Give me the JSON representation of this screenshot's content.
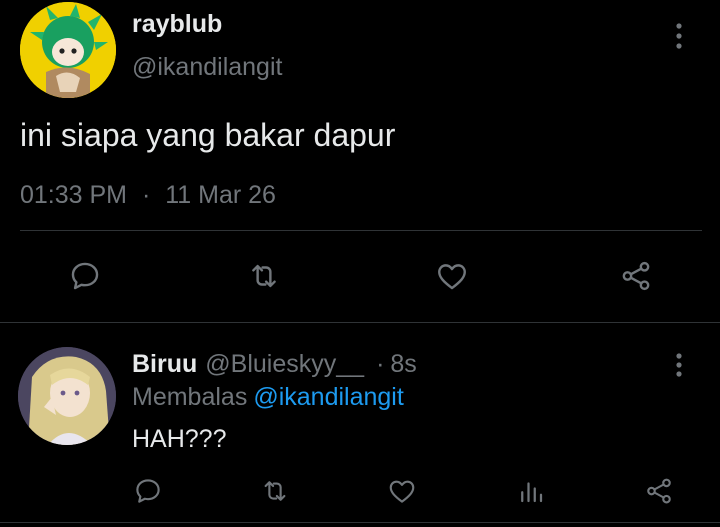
{
  "tweet": {
    "author_name": "rayblub",
    "author_handle": "@ikandilangit",
    "text": "ini siapa yang bakar dapur",
    "time": "01:33 PM",
    "separator": "·",
    "date": "11 Mar 26"
  },
  "reply": {
    "author_name": "Biruu",
    "author_handle": "@Bluieskyy__",
    "separator": "·",
    "time_ago": "8s",
    "replying_prefix": "Membalas",
    "replying_handle": "@ikandilangit",
    "text": "HAH???"
  },
  "icons": {
    "reply": "reply-icon",
    "retweet": "retweet-icon",
    "like": "like-icon",
    "share": "share-icon",
    "views": "views-icon",
    "more": "more-vertical-icon"
  },
  "colors": {
    "background": "#000000",
    "text_primary": "#e7e9ea",
    "text_secondary": "#71767b",
    "link": "#1d9bf0",
    "divider": "#2f3336"
  }
}
